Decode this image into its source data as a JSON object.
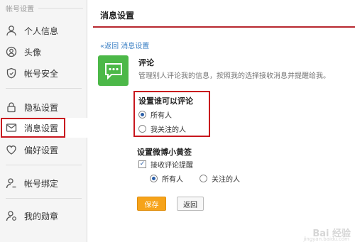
{
  "sidebar": {
    "header": "帐号设置",
    "items": [
      {
        "label": "个人信息",
        "icon": "person-icon"
      },
      {
        "label": "头像",
        "icon": "avatar-icon"
      },
      {
        "label": "帐号安全",
        "icon": "shield-icon"
      },
      {
        "label": "隐私设置",
        "icon": "lock-icon"
      },
      {
        "label": "消息设置",
        "icon": "message-icon"
      },
      {
        "label": "偏好设置",
        "icon": "heart-icon"
      },
      {
        "label": "帐号绑定",
        "icon": "link-person-icon"
      },
      {
        "label": "我的勋章",
        "icon": "medal-icon"
      }
    ],
    "active_index": 4
  },
  "main": {
    "title": "消息设置",
    "back_link": "«返回 消息设置",
    "section_title": "评论",
    "section_desc": "管理别人评论我的信息，按照我的选择接收消息并提醒给我。",
    "who_can_comment": {
      "title": "设置谁可以评论",
      "options": [
        "所有人",
        "我关注的人"
      ],
      "selected": 0
    },
    "tip": {
      "title": "设置微博小黄签",
      "checkbox_label": "接收评论提醒",
      "checked": true,
      "options": [
        "所有人",
        "关注的人"
      ],
      "selected": 0
    },
    "save_label": "保存",
    "back_label": "返回"
  },
  "watermark": {
    "text": "Bai 经验",
    "url": "jingyan.baidu.com"
  },
  "colors": {
    "highlight_red": "#c8171e",
    "title_line": "#b8282f",
    "link_blue": "#3a7fc4",
    "icon_green": "#4cb848",
    "save_orange": "#f6a31a"
  }
}
